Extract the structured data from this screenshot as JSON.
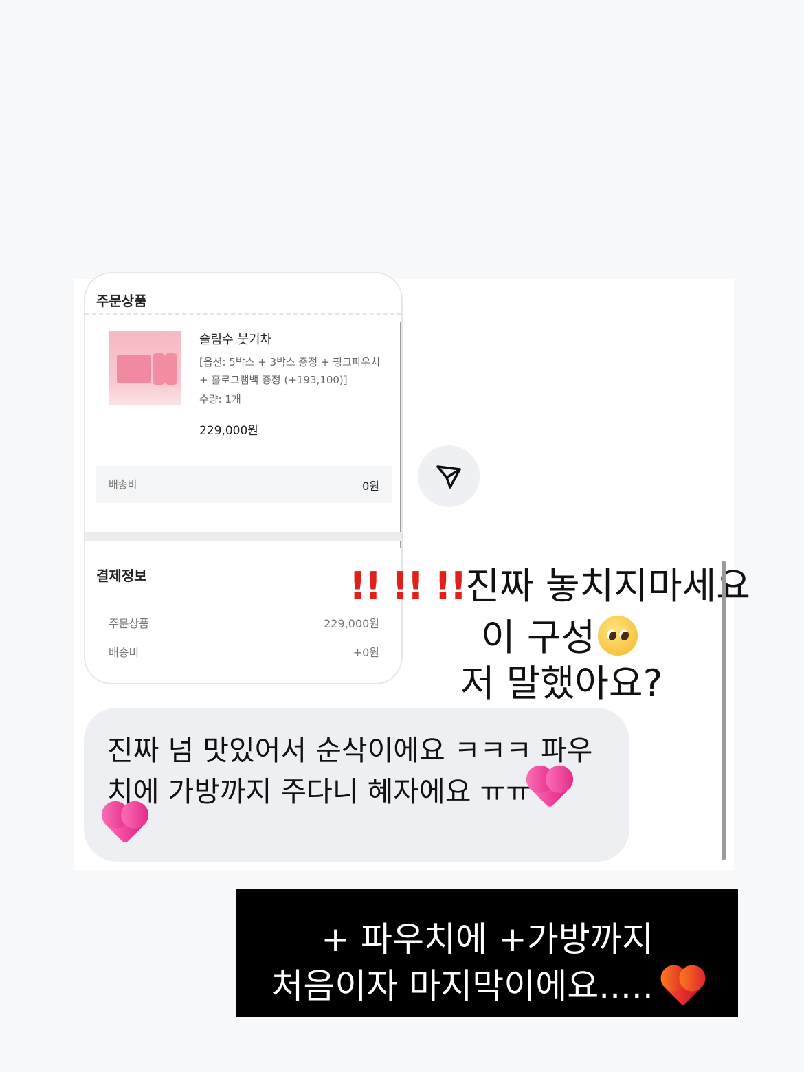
{
  "order_card": {
    "section_title": "주문상품",
    "product": {
      "name": "슬림수 붓기차",
      "option_line1": "[옵션: 5박스 + 3박스 증정 + 핑크파우치",
      "option_line2": "+ 홀로그램백 증정 (+193,100)]",
      "quantity": "수량: 1개",
      "price": "229,000원"
    },
    "shipping": {
      "label": "배송비",
      "value": "0원"
    },
    "payment": {
      "title": "결제정보",
      "rows": [
        {
          "label": "주문상품",
          "value": "229,000원"
        },
        {
          "label": "배송비",
          "value": "+0원"
        }
      ]
    }
  },
  "send_button": {
    "icon": "send-icon"
  },
  "story_text": {
    "exclamations": "!! !! !!",
    "line1": "진짜 놓치지마세요",
    "line2": "이 구성",
    "line2_emoji": "pleading-face",
    "line3": "저 말했아요?"
  },
  "review_bubble": {
    "line1": "진짜 넘 맛있어서 순삭이에요 ㅋㅋㅋ 파우",
    "line2": "치에 가방까지 주다니 혜자에요 ㅠㅠ",
    "emoji": "sparkling-heart"
  },
  "banner": {
    "line1": "+ 파우치에 +가방까지",
    "line2": "처음이자 마지막이에요.....",
    "emoji": "heart-on-fire"
  },
  "colors": {
    "accent_red": "#e0201b",
    "bubble_bg": "#eeeff3",
    "banner_bg": "#000000"
  }
}
